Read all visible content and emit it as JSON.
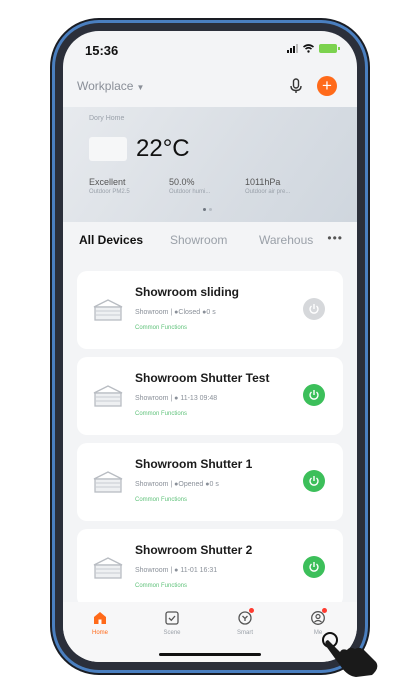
{
  "status_bar": {
    "time": "15:36"
  },
  "header": {
    "home_name": "Workplace"
  },
  "weather": {
    "location_label": "Dory Home",
    "temperature": "22°C",
    "metrics": [
      {
        "value": "Excellent",
        "label": "Outdoor PM2.5"
      },
      {
        "value": "50.0%",
        "label": "Outdoor humi..."
      },
      {
        "value": "1011hPa",
        "label": "Outdoor air pre..."
      }
    ]
  },
  "tabs": [
    {
      "label": "All Devices",
      "active": true
    },
    {
      "label": "Showroom",
      "active": false
    },
    {
      "label": "Warehous",
      "active": false
    }
  ],
  "devices": [
    {
      "name": "Showroom sliding",
      "status": "Showroom | ●Closed ●0 s",
      "function": "Common Functions",
      "power": "off"
    },
    {
      "name": "Showroom Shutter Test",
      "status": "Showroom | ● 11-13 09:48",
      "function": "Common Functions",
      "power": "on"
    },
    {
      "name": "Showroom Shutter 1",
      "status": "Showroom | ●Opened ●0 s",
      "function": "Common Functions",
      "power": "on"
    },
    {
      "name": "Showroom Shutter 2",
      "status": "Showroom | ● 11-01 16:31",
      "function": "Common Functions",
      "power": "on"
    }
  ],
  "tabbar": [
    {
      "label": "Home",
      "icon": "home-icon",
      "active": true
    },
    {
      "label": "Scene",
      "icon": "scene-icon",
      "active": false
    },
    {
      "label": "Smart",
      "icon": "smart-icon",
      "active": false
    },
    {
      "label": "Me",
      "icon": "me-icon",
      "active": false
    }
  ],
  "colors": {
    "accent": "#ff6a1a",
    "power_on": "#3cbf5a",
    "power_off": "#d6d8db",
    "function_text": "#5fc27a"
  }
}
